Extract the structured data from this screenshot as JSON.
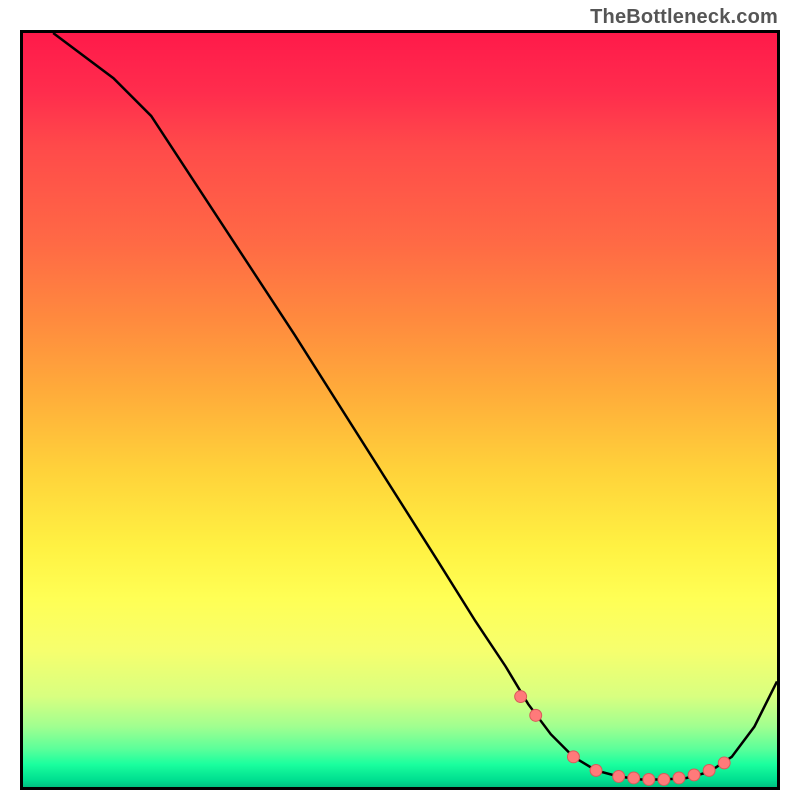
{
  "watermark": "TheBottleneck.com",
  "chart_data": {
    "type": "line",
    "title": "",
    "xlabel": "",
    "ylabel": "",
    "xlim": [
      0,
      100
    ],
    "ylim": [
      0,
      100
    ],
    "grid": false,
    "legend": false,
    "series": [
      {
        "name": "bottleneck-curve",
        "x": [
          4,
          8,
          12,
          17,
          36,
          55,
          60,
          64,
          67,
          70,
          73,
          76,
          79,
          82,
          85,
          88,
          91,
          94,
          97,
          100
        ],
        "y": [
          100,
          97,
          94,
          89,
          60,
          30,
          22,
          16,
          11,
          7,
          4,
          2.2,
          1.4,
          1,
          1,
          1.2,
          2,
          4,
          8,
          14
        ],
        "color": "#000000"
      }
    ],
    "markers": {
      "name": "highlighted-dots",
      "x": [
        66,
        68,
        73,
        76,
        79,
        81,
        83,
        85,
        87,
        89,
        91,
        93
      ],
      "y": [
        12,
        9.5,
        4,
        2.2,
        1.4,
        1.2,
        1,
        1,
        1.2,
        1.6,
        2.2,
        3.2
      ],
      "color": "#ff7a7a"
    },
    "background_gradient": {
      "direction": "top-to-bottom",
      "stops": [
        {
          "pos": 0,
          "color": "#ff1a4a"
        },
        {
          "pos": 50,
          "color": "#ffc040"
        },
        {
          "pos": 75,
          "color": "#ffff55"
        },
        {
          "pos": 100,
          "color": "#00c080"
        }
      ]
    }
  }
}
